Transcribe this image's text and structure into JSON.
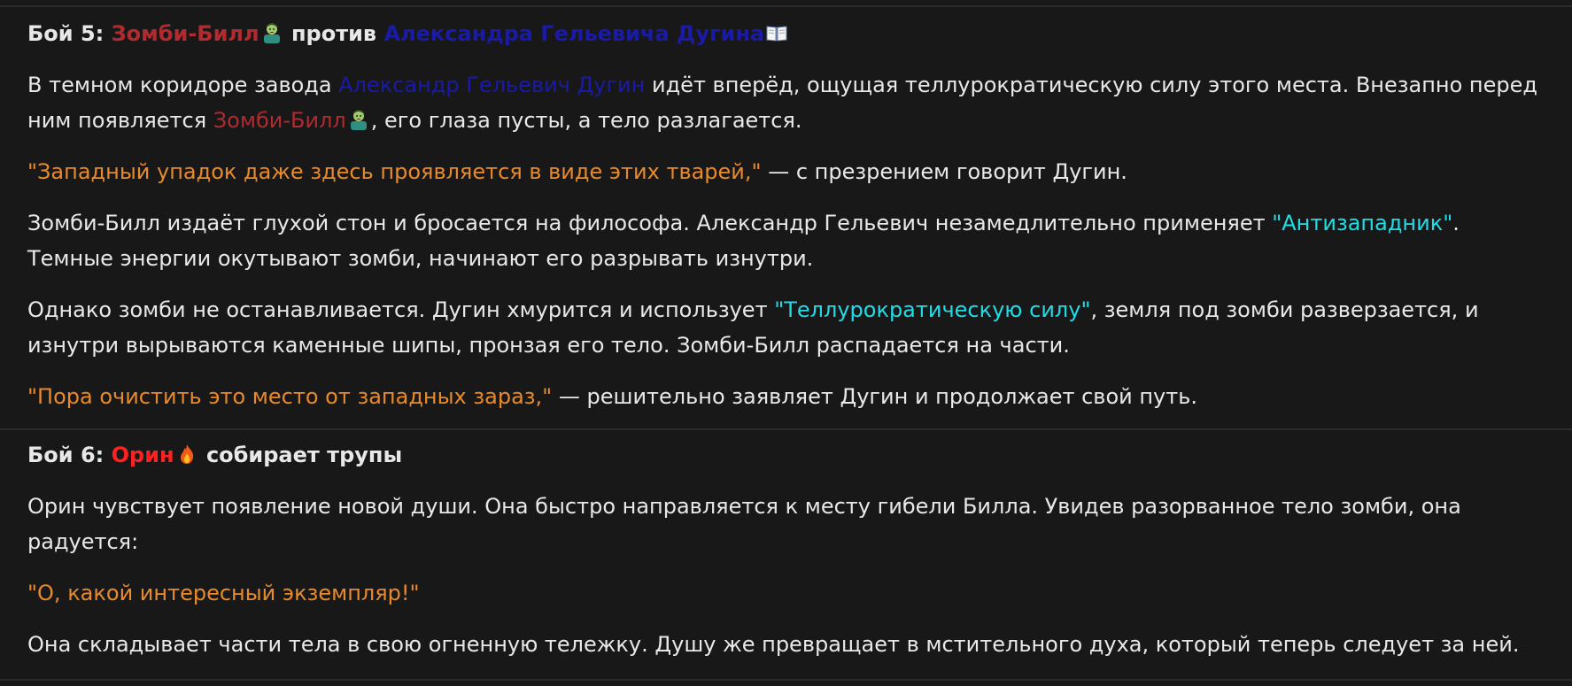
{
  "colors": {
    "background": "#181818",
    "text": "#e8e8e8",
    "zombie_name": "#b02a30",
    "dugin_name": "#1a1aa8",
    "quote": "#e88a2c",
    "skill": "#20dce6",
    "orin_name": "#ff2020"
  },
  "fight5": {
    "heading": {
      "prefix": "Бой 5:",
      "zombie": "Зомби-Билл",
      "versus": "против",
      "dugin": "Александра Гельевича Дугина"
    },
    "p1": {
      "a": "В темном коридоре завода",
      "name": "Александр Гельевич Дугин",
      "b": "идёт вперёд, ощущая теллурократическую силу этого места. Внезапно перед",
      "c": "ним появляется",
      "zombie": "Зомби-Билл",
      "d": ", его глаза пусты, а тело разлагается."
    },
    "p2": {
      "quote": "\"Западный упадок даже здесь проявляется в виде этих тварей,\"",
      "rest": " — с презрением говорит Дугин."
    },
    "p3": {
      "a": "Зомби-Билл издаёт глухой стон и бросается на философа. Александр Гельевич незамедлительно применяет",
      "skill": "\"Антизападник\"",
      "b": ".",
      "c": "Темные энергии окутывают зомби, начинают его разрывать изнутри."
    },
    "p4": {
      "a": "Однако зомби не останавливается. Дугин хмурится и использует",
      "skill": "\"Теллурократическую силу\"",
      "b": ", земля под зомби разверзается, и",
      "c": "изнутри вырываются каменные шипы, пронзая его тело. Зомби-Билл распадается на части."
    },
    "p5": {
      "quote": "\"Пора очистить это место от западных зараз,\"",
      "rest": " — решительно заявляет Дугин и продолжает свой путь."
    }
  },
  "fight6": {
    "heading": {
      "prefix": "Бой 6:",
      "orin": "Орин",
      "rest": "собирает трупы"
    },
    "p1": {
      "a": "Орин чувствует появление новой души. Она быстро направляется к месту гибели Билла. Увидев разорванное тело зомби, она",
      "b": "радуется:"
    },
    "p2": {
      "quote": "\"О, какой интересный экземпляр!\""
    },
    "p3": {
      "a": "Она складывает части тела в свою огненную тележку. Душу же превращает в мстительного духа, который теперь следует за ней."
    }
  },
  "icons": {
    "zombie": "zombie-emoji-icon",
    "book": "open-book-emoji-icon",
    "fire": "fire-emoji-icon"
  }
}
